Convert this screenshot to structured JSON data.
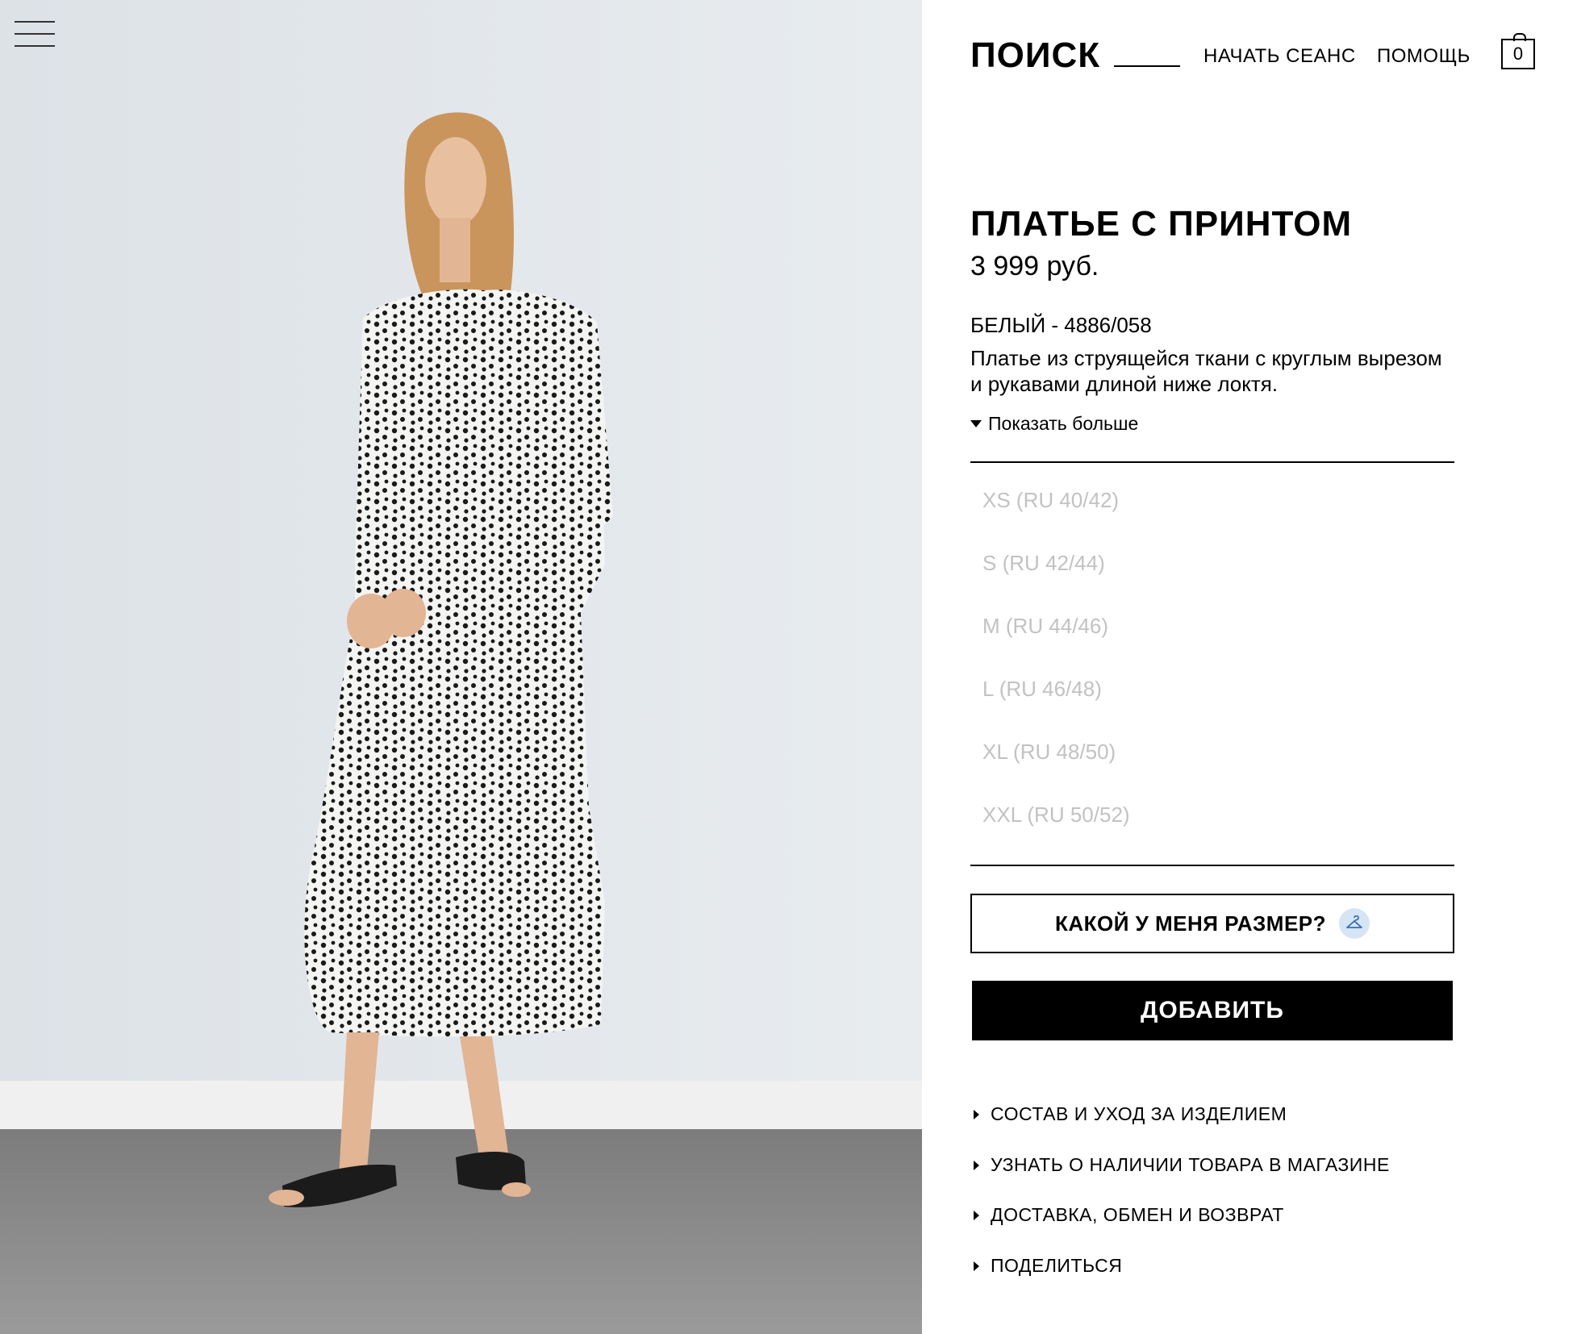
{
  "header": {
    "search_label": "ПОИСК",
    "login_label": "НАЧАТЬ СЕАНС",
    "help_label": "ПОМОЩЬ",
    "cart_count": "0"
  },
  "product": {
    "title": "ПЛАТЬЕ С ПРИНТОМ",
    "price": "3 999 руб.",
    "color_ref": "БЕЛЫЙ - 4886/058",
    "description": "Платье из струящейся ткани с круглым вырезом и рукавами длиной ниже локтя.",
    "show_more": "Показать больше"
  },
  "sizes": [
    {
      "label": "XS (RU 40/42)"
    },
    {
      "label": "S (RU 42/44)"
    },
    {
      "label": "M (RU 44/46)"
    },
    {
      "label": "L (RU 46/48)"
    },
    {
      "label": "XL (RU 48/50)"
    },
    {
      "label": "XXL (RU 50/52)"
    }
  ],
  "buttons": {
    "size_guide": "КАКОЙ У МЕНЯ РАЗМЕР?",
    "add_to_cart": "ДОБАВИТЬ"
  },
  "info_links": [
    {
      "label": "СОСТАВ И УХОД ЗА ИЗДЕЛИЕМ"
    },
    {
      "label": "УЗНАТЬ О НАЛИЧИИ ТОВАРА В МАГАЗИНЕ"
    },
    {
      "label": "ДОСТАВКА, ОБМЕН И ВОЗВРАТ"
    },
    {
      "label": "ПОДЕЛИТЬСЯ"
    }
  ],
  "colors": {
    "size_unavailable": "#c2c2c2",
    "hanger_badge": "#d5e5f6",
    "photo_wall": "#e4e8ec",
    "photo_floor": "#8a8a8a"
  }
}
